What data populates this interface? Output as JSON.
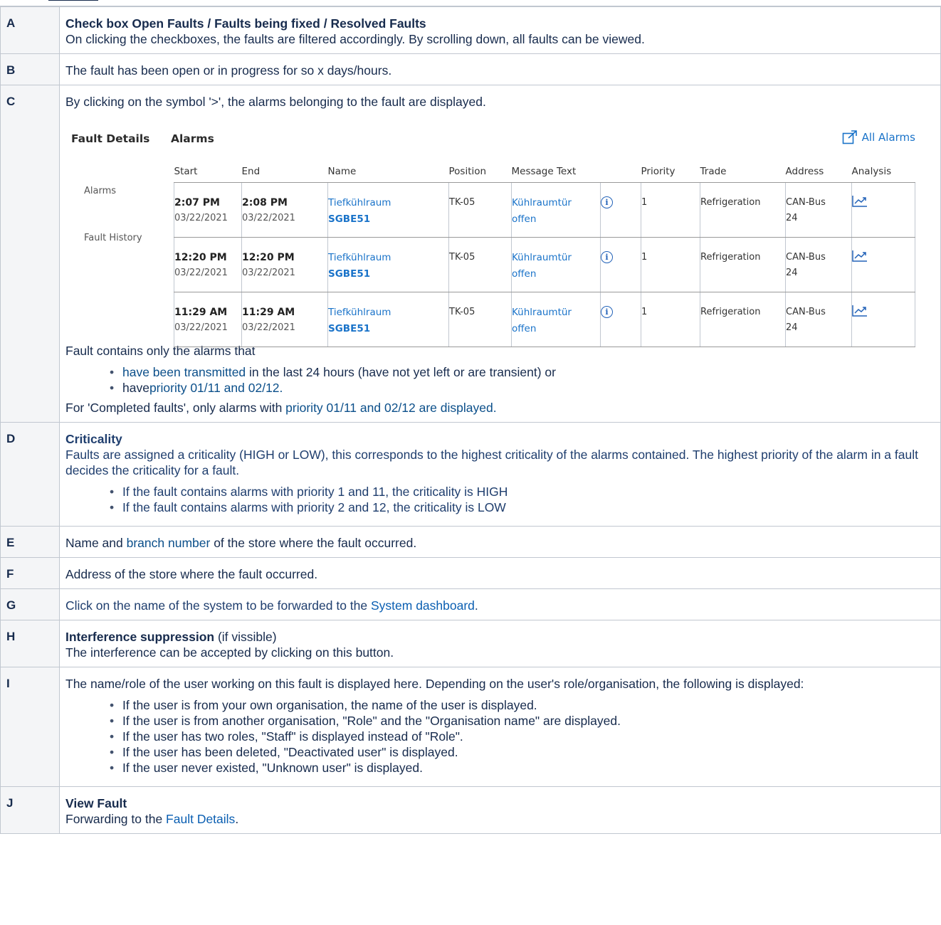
{
  "rows": [
    {
      "key": "A",
      "title_parts": [
        "Check box Open Faults",
        " / ",
        "Faults being fixed",
        " / ",
        "Resolved Faults"
      ],
      "text": "On clicking the checkboxes, the faults are filtered accordingly. By scrolling down, all faults can be viewed."
    },
    {
      "key": "B",
      "text": "The fault has been open or in progress for so x days/hours."
    },
    {
      "key": "C",
      "text": "By clicking on the symbol '>', the alarms belonging to the fault are displayed.",
      "after": "Fault contains only the alarms that",
      "bullets": [
        {
          "a": "have been transmitted",
          "b": " in the last 24 hours (have not yet left or are transient) or"
        },
        {
          "a": "have",
          "b": "priority 01/11 and 02/12."
        }
      ],
      "completed": {
        "p1": "For 'Completed ",
        "p2": "faults', only alarms with ",
        "p3": "priority 01/11 and 02/12 are displayed."
      }
    },
    {
      "key": "D",
      "title": "Criticality",
      "text": "Faults are assigned a criticality (HIGH or LOW), this corresponds to the highest criticality of the alarms contained. The highest priority of the alarm in a fault decides the criticality for a fault.",
      "bullets": [
        "If the fault contains alarms with priority 1 and 11, the criticality is HIGH",
        "If the fault contains alarms with priority 2 and 12, the criticality is LOW"
      ]
    },
    {
      "key": "E",
      "p1": "Name and ",
      "link": "branch number",
      "p2": " of the store where the fault occurred."
    },
    {
      "key": "F",
      "text": "Address of the store where the fault occurred."
    },
    {
      "key": "G",
      "p1": "Click on the name of the system to be forwarded to the ",
      "link": "System dashboard",
      "p2": "."
    },
    {
      "key": "H",
      "title": "Interference suppression",
      "title_suffix": " (if vissible)",
      "text": "The interference can be accepted by clicking on this button."
    },
    {
      "key": "I",
      "text": "The name/role of the user working on this fault is displayed here. Depending on the user's role/organisation, the following is displayed:",
      "bullets": [
        "If the user is from your own organisation, the name of the user is displayed.",
        "If the user is from another organisation, \"Role\" and the \"Organisation name\" are displayed.",
        "If the user has two roles, \"Staff\" is displayed instead of \"Role\".",
        "If the user has been deleted, \"Deactivated user\" is displayed.",
        "If the user never existed, \"Unknown user\" is displayed."
      ]
    },
    {
      "key": "J",
      "title": "View Fault",
      "p1": "Forwarding to the ",
      "link": "Fault Details",
      "p2": "."
    }
  ],
  "screenshot": {
    "heading_left": "Fault Details",
    "heading_right": "Alarms",
    "all_alarms": "All Alarms",
    "side": [
      "Alarms",
      "Fault History"
    ],
    "columns": [
      "Start",
      "End",
      "Name",
      "Position",
      "Message Text",
      "",
      "Priority",
      "Trade",
      "Address",
      "Analysis"
    ],
    "alarms": [
      {
        "start_time": "2:07 PM",
        "start_date": "03/22/2021",
        "end_time": "2:08 PM",
        "end_date": "03/22/2021",
        "name1": "Tiefkühlraum",
        "name2": "SGBE51",
        "position": "TK-05",
        "msg1": "Kühlraumtür",
        "msg2": "offen",
        "priority": "1",
        "trade": "Refrigeration",
        "addr1": "CAN-Bus",
        "addr2": "24"
      },
      {
        "start_time": "12:20 PM",
        "start_date": "03/22/2021",
        "end_time": "12:20 PM",
        "end_date": "03/22/2021",
        "name1": "Tiefkühlraum",
        "name2": "SGBE51",
        "position": "TK-05",
        "msg1": "Kühlraumtür",
        "msg2": "offen",
        "priority": "1",
        "trade": "Refrigeration",
        "addr1": "CAN-Bus",
        "addr2": "24"
      },
      {
        "start_time": "11:29 AM",
        "start_date": "03/22/2021",
        "end_time": "11:29 AM",
        "end_date": "03/22/2021",
        "name1": "Tiefkühlraum",
        "name2": "SGBE51",
        "position": "TK-05",
        "msg1": "Kühlraumtür",
        "msg2": "offen",
        "priority": "1",
        "trade": "Refrigeration",
        "addr1": "CAN-Bus",
        "addr2": "24"
      }
    ]
  }
}
